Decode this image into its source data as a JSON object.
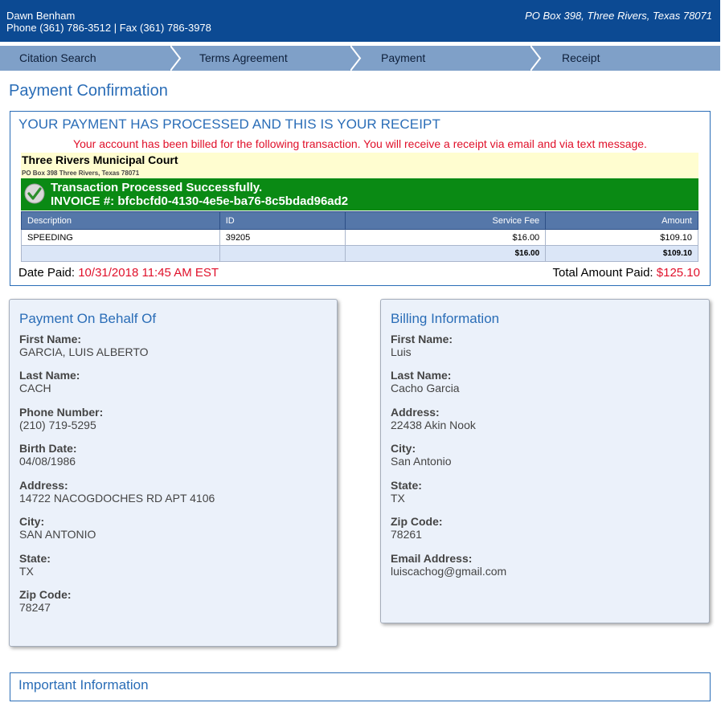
{
  "header": {
    "name": "Dawn Benham",
    "contact": "Phone (361) 786-3512 | Fax (361) 786-3978",
    "address": "PO Box 398, Three Rivers, Texas 78071"
  },
  "steps": [
    "Citation Search",
    "Terms Agreement",
    "Payment",
    "Receipt"
  ],
  "page_title": "Payment Confirmation",
  "receipt": {
    "heading": "YOUR PAYMENT HAS PROCESSED AND THIS IS YOUR RECEIPT",
    "billed_message": "Your account has been billed for the following transaction. You will receive a receipt via email and via text message.",
    "court_name": "Three Rivers Municipal Court",
    "court_address": "PO Box 398 Three Rivers, Texas 78071",
    "success_line": "Transaction Processed Successfully.",
    "invoice_line": "INVOICE #: bfcbcfd0-4130-4e5e-ba76-8c5bdad96ad2",
    "table": {
      "headers": [
        "Description",
        "ID",
        "Service Fee",
        "Amount"
      ],
      "row": [
        "SPEEDING",
        "39205",
        "$16.00",
        "$109.10"
      ],
      "totals": [
        "",
        "",
        "$16.00",
        "$109.10"
      ]
    },
    "date_paid_label": "Date Paid:",
    "date_paid_value": "10/31/2018 11:45 AM EST",
    "total_label": "Total Amount Paid:",
    "total_value": "$125.10"
  },
  "on_behalf": {
    "title": "Payment On Behalf Of",
    "fields": [
      {
        "label": "First Name:",
        "value": "GARCIA, LUIS ALBERTO"
      },
      {
        "label": "Last Name:",
        "value": "CACH"
      },
      {
        "label": "Phone Number:",
        "value": "(210) 719-5295"
      },
      {
        "label": "Birth Date:",
        "value": "04/08/1986"
      },
      {
        "label": "Address:",
        "value": "14722 NACOGDOCHES RD APT 4106"
      },
      {
        "label": "City:",
        "value": "SAN ANTONIO"
      },
      {
        "label": "State:",
        "value": "TX"
      },
      {
        "label": "Zip Code:",
        "value": "78247"
      }
    ]
  },
  "billing": {
    "title": "Billing Information",
    "fields": [
      {
        "label": "First Name:",
        "value": "Luis"
      },
      {
        "label": "Last Name:",
        "value": "Cacho Garcia"
      },
      {
        "label": "Address:",
        "value": "22438 Akin Nook"
      },
      {
        "label": "City:",
        "value": "San Antonio"
      },
      {
        "label": "State:",
        "value": "TX"
      },
      {
        "label": "Zip Code:",
        "value": "78261"
      },
      {
        "label": "Email Address:",
        "value": "luiscachog@gmail.com"
      }
    ]
  },
  "important_info": {
    "title": "Important Information"
  },
  "colors": {
    "header_bg": "#0c4a93",
    "steps_bg": "#7fa0c8",
    "accent_blue": "#2a6db7",
    "alert_red": "#e0102a",
    "success_green": "#0a8a14",
    "court_bg": "#fffdd0",
    "panel_bg": "#ebf1fa"
  },
  "icons": {
    "success": "checkmark-icon",
    "step_separator": "chevron-right-icon"
  }
}
